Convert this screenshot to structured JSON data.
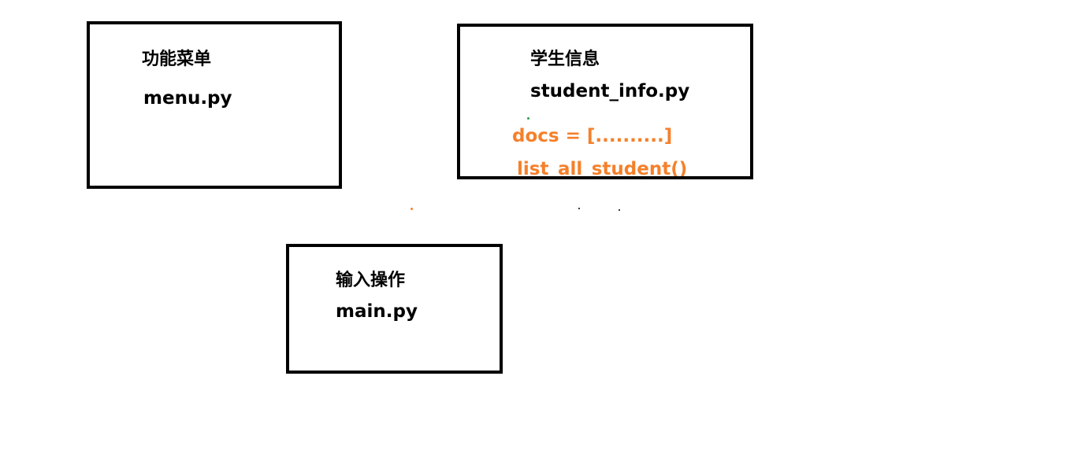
{
  "modules": {
    "menu": {
      "title": "功能菜单",
      "file": "menu.py"
    },
    "student_info": {
      "title": "学生信息",
      "file": "student_info.py",
      "code_lines": [
        "docs = [..........]",
        "list_all_student()"
      ]
    },
    "main": {
      "title": "输入操作",
      "file": "main.py"
    }
  },
  "colors": {
    "border": "#000000",
    "text": "#000000",
    "code": "#f5802a",
    "background": "#ffffff"
  }
}
